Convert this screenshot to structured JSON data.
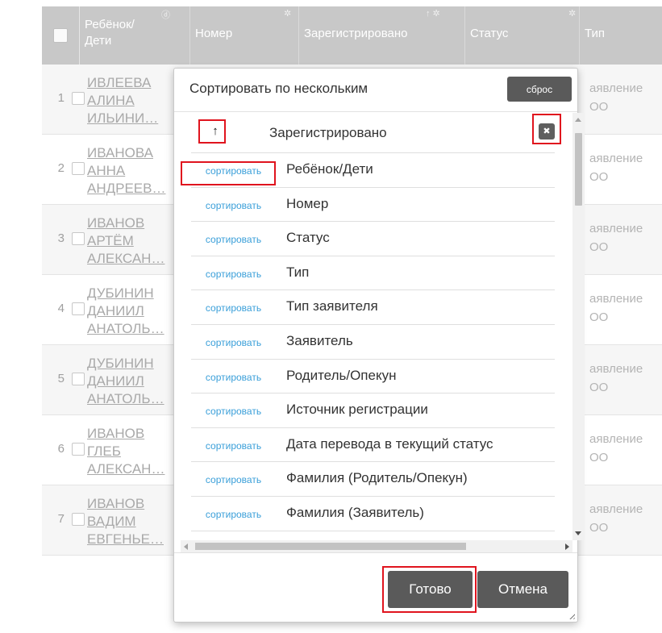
{
  "table": {
    "headers": [
      {
        "label": "Ребёнок/ Дети",
        "icon": "eye-off-icon",
        "icon_char": "ⓓ"
      },
      {
        "label": "Номер",
        "icon": "gear-icon",
        "icon_char": "✲"
      },
      {
        "label": "Зарегистрировано",
        "icon": "sort-asc-gear-icon",
        "icon_char": "↑ ✲"
      },
      {
        "label": "Статус",
        "icon": "gear-icon",
        "icon_char": "✲"
      },
      {
        "label": "Тип",
        "icon": "",
        "icon_char": ""
      }
    ],
    "rows": [
      {
        "num": "1",
        "line1": "ИВЛЕЕВА",
        "line2": "АЛИНА",
        "line3": "ИЛЬИНИ…",
        "type1": "аявление",
        "type2": "ОО"
      },
      {
        "num": "2",
        "line1": "ИВАНОВА",
        "line2": "АННА",
        "line3": "АНДРЕЕВ…",
        "type1": "аявление",
        "type2": "ОО"
      },
      {
        "num": "3",
        "line1": "ИВАНОВ",
        "line2": "АРТЁМ",
        "line3": "АЛЕКСАН…",
        "type1": "аявление",
        "type2": "ОО"
      },
      {
        "num": "4",
        "line1": "ДУБИНИН",
        "line2": "ДАНИИЛ",
        "line3": "АНАТОЛЬ…",
        "type1": "аявление",
        "type2": "ОО"
      },
      {
        "num": "5",
        "line1": "ДУБИНИН",
        "line2": "ДАНИИЛ",
        "line3": "АНАТОЛЬ…",
        "type1": "аявление",
        "type2": "ОО"
      },
      {
        "num": "6",
        "line1": "ИВАНОВ",
        "line2": "ГЛЕБ",
        "line3": "АЛЕКСАН…",
        "type1": "аявление",
        "type2": "ОО"
      },
      {
        "num": "7",
        "line1": "ИВАНОВ",
        "line2": "ВАДИМ",
        "line3": "ЕВГЕНЬЕ…",
        "type1": "аявление",
        "type2": "ОО"
      }
    ]
  },
  "modal": {
    "title": "Сортировать по нескольким",
    "reset_label": "сброс",
    "active_sort": {
      "direction_char": "↑",
      "label": "Зарегистрировано",
      "remove_char": "✖"
    },
    "sort_link_label": "сортировать",
    "sort_options": [
      "Ребёнок/Дети",
      "Номер",
      "Статус",
      "Тип",
      "Тип заявителя",
      "Заявитель",
      "Родитель/Опекун",
      "Источник регистрации",
      "Дата перевода в текущий статус",
      "Фамилия (Родитель/Опекун)",
      "Фамилия (Заявитель)"
    ],
    "done_label": "Готово",
    "cancel_label": "Отмена"
  },
  "colors": {
    "header_bg": "#c8c8c8",
    "button_bg": "#5a5a5a",
    "link": "#3a9fd9",
    "highlight_box": "#e0141e"
  }
}
